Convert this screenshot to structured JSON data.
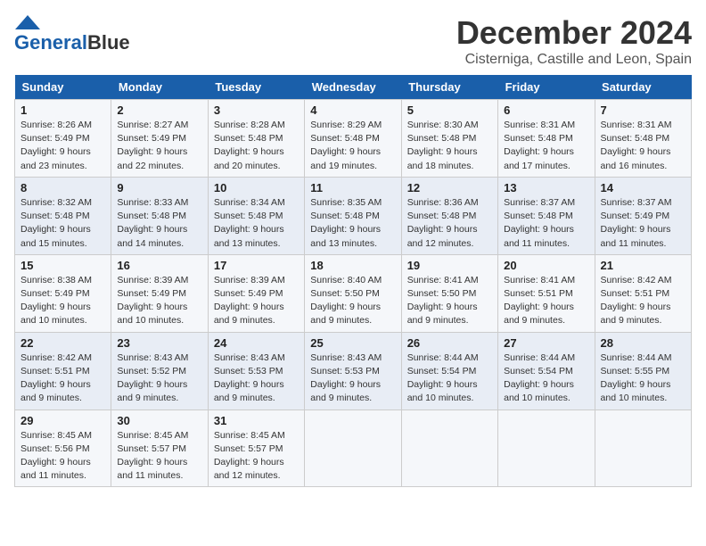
{
  "header": {
    "logo_line1": "General",
    "logo_line2": "Blue",
    "month_title": "December 2024",
    "location": "Cisterniga, Castille and Leon, Spain"
  },
  "days_of_week": [
    "Sunday",
    "Monday",
    "Tuesday",
    "Wednesday",
    "Thursday",
    "Friday",
    "Saturday"
  ],
  "weeks": [
    [
      {
        "day": "1",
        "sunrise": "8:26 AM",
        "sunset": "5:49 PM",
        "daylight": "9 hours and 23 minutes."
      },
      {
        "day": "2",
        "sunrise": "8:27 AM",
        "sunset": "5:49 PM",
        "daylight": "9 hours and 22 minutes."
      },
      {
        "day": "3",
        "sunrise": "8:28 AM",
        "sunset": "5:48 PM",
        "daylight": "9 hours and 20 minutes."
      },
      {
        "day": "4",
        "sunrise": "8:29 AM",
        "sunset": "5:48 PM",
        "daylight": "9 hours and 19 minutes."
      },
      {
        "day": "5",
        "sunrise": "8:30 AM",
        "sunset": "5:48 PM",
        "daylight": "9 hours and 18 minutes."
      },
      {
        "day": "6",
        "sunrise": "8:31 AM",
        "sunset": "5:48 PM",
        "daylight": "9 hours and 17 minutes."
      },
      {
        "day": "7",
        "sunrise": "8:31 AM",
        "sunset": "5:48 PM",
        "daylight": "9 hours and 16 minutes."
      }
    ],
    [
      {
        "day": "8",
        "sunrise": "8:32 AM",
        "sunset": "5:48 PM",
        "daylight": "9 hours and 15 minutes."
      },
      {
        "day": "9",
        "sunrise": "8:33 AM",
        "sunset": "5:48 PM",
        "daylight": "9 hours and 14 minutes."
      },
      {
        "day": "10",
        "sunrise": "8:34 AM",
        "sunset": "5:48 PM",
        "daylight": "9 hours and 13 minutes."
      },
      {
        "day": "11",
        "sunrise": "8:35 AM",
        "sunset": "5:48 PM",
        "daylight": "9 hours and 13 minutes."
      },
      {
        "day": "12",
        "sunrise": "8:36 AM",
        "sunset": "5:48 PM",
        "daylight": "9 hours and 12 minutes."
      },
      {
        "day": "13",
        "sunrise": "8:37 AM",
        "sunset": "5:48 PM",
        "daylight": "9 hours and 11 minutes."
      },
      {
        "day": "14",
        "sunrise": "8:37 AM",
        "sunset": "5:49 PM",
        "daylight": "9 hours and 11 minutes."
      }
    ],
    [
      {
        "day": "15",
        "sunrise": "8:38 AM",
        "sunset": "5:49 PM",
        "daylight": "9 hours and 10 minutes."
      },
      {
        "day": "16",
        "sunrise": "8:39 AM",
        "sunset": "5:49 PM",
        "daylight": "9 hours and 10 minutes."
      },
      {
        "day": "17",
        "sunrise": "8:39 AM",
        "sunset": "5:49 PM",
        "daylight": "9 hours and 9 minutes."
      },
      {
        "day": "18",
        "sunrise": "8:40 AM",
        "sunset": "5:50 PM",
        "daylight": "9 hours and 9 minutes."
      },
      {
        "day": "19",
        "sunrise": "8:41 AM",
        "sunset": "5:50 PM",
        "daylight": "9 hours and 9 minutes."
      },
      {
        "day": "20",
        "sunrise": "8:41 AM",
        "sunset": "5:51 PM",
        "daylight": "9 hours and 9 minutes."
      },
      {
        "day": "21",
        "sunrise": "8:42 AM",
        "sunset": "5:51 PM",
        "daylight": "9 hours and 9 minutes."
      }
    ],
    [
      {
        "day": "22",
        "sunrise": "8:42 AM",
        "sunset": "5:51 PM",
        "daylight": "9 hours and 9 minutes."
      },
      {
        "day": "23",
        "sunrise": "8:43 AM",
        "sunset": "5:52 PM",
        "daylight": "9 hours and 9 minutes."
      },
      {
        "day": "24",
        "sunrise": "8:43 AM",
        "sunset": "5:53 PM",
        "daylight": "9 hours and 9 minutes."
      },
      {
        "day": "25",
        "sunrise": "8:43 AM",
        "sunset": "5:53 PM",
        "daylight": "9 hours and 9 minutes."
      },
      {
        "day": "26",
        "sunrise": "8:44 AM",
        "sunset": "5:54 PM",
        "daylight": "9 hours and 10 minutes."
      },
      {
        "day": "27",
        "sunrise": "8:44 AM",
        "sunset": "5:54 PM",
        "daylight": "9 hours and 10 minutes."
      },
      {
        "day": "28",
        "sunrise": "8:44 AM",
        "sunset": "5:55 PM",
        "daylight": "9 hours and 10 minutes."
      }
    ],
    [
      {
        "day": "29",
        "sunrise": "8:45 AM",
        "sunset": "5:56 PM",
        "daylight": "9 hours and 11 minutes."
      },
      {
        "day": "30",
        "sunrise": "8:45 AM",
        "sunset": "5:57 PM",
        "daylight": "9 hours and 11 minutes."
      },
      {
        "day": "31",
        "sunrise": "8:45 AM",
        "sunset": "5:57 PM",
        "daylight": "9 hours and 12 minutes."
      },
      null,
      null,
      null,
      null
    ]
  ],
  "labels": {
    "sunrise": "Sunrise: ",
    "sunset": "Sunset: ",
    "daylight": "Daylight: "
  }
}
